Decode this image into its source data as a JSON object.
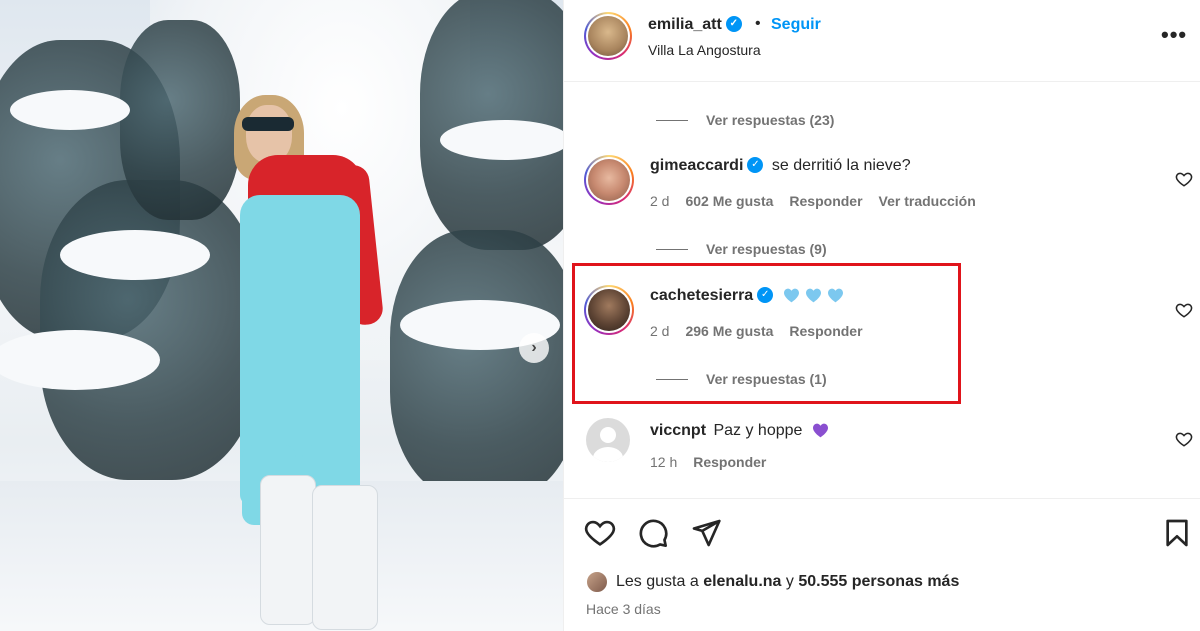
{
  "post": {
    "author": "emilia_att",
    "follow_label": "Seguir",
    "separator": "•",
    "location": "Villa La Angostura",
    "more_label": "•••",
    "next_label": "›"
  },
  "comments": [
    {
      "view_replies": "Ver respuestas (23)"
    },
    {
      "username": "gimeaccardi",
      "text": "se derritió la nieve?",
      "time": "2 d",
      "likes": "602 Me gusta",
      "reply": "Responder",
      "translate": "Ver traducción",
      "view_replies": "Ver respuestas (9)"
    },
    {
      "username": "cachetesierra",
      "text": "",
      "emoji": [
        "light-blue-heart",
        "light-blue-heart",
        "light-blue-heart"
      ],
      "time": "2 d",
      "likes": "296 Me gusta",
      "reply": "Responder",
      "view_replies": "Ver respuestas (1)"
    },
    {
      "username": "viccnpt",
      "text": "Paz y hoppe",
      "emoji": [
        "purple-heart"
      ],
      "time": "12 h",
      "reply": "Responder"
    }
  ],
  "footer": {
    "likes_prefix": "Les gusta a",
    "liker": "elenalu.na",
    "likes_join": "y",
    "likes_count": "50.555 personas más",
    "time_ago": "Hace 3 días"
  },
  "colors": {
    "accent": "#0095f6",
    "highlight": "#e0141b",
    "light_blue_heart": "#7cc8ef",
    "purple_heart": "#8a4fd0"
  }
}
